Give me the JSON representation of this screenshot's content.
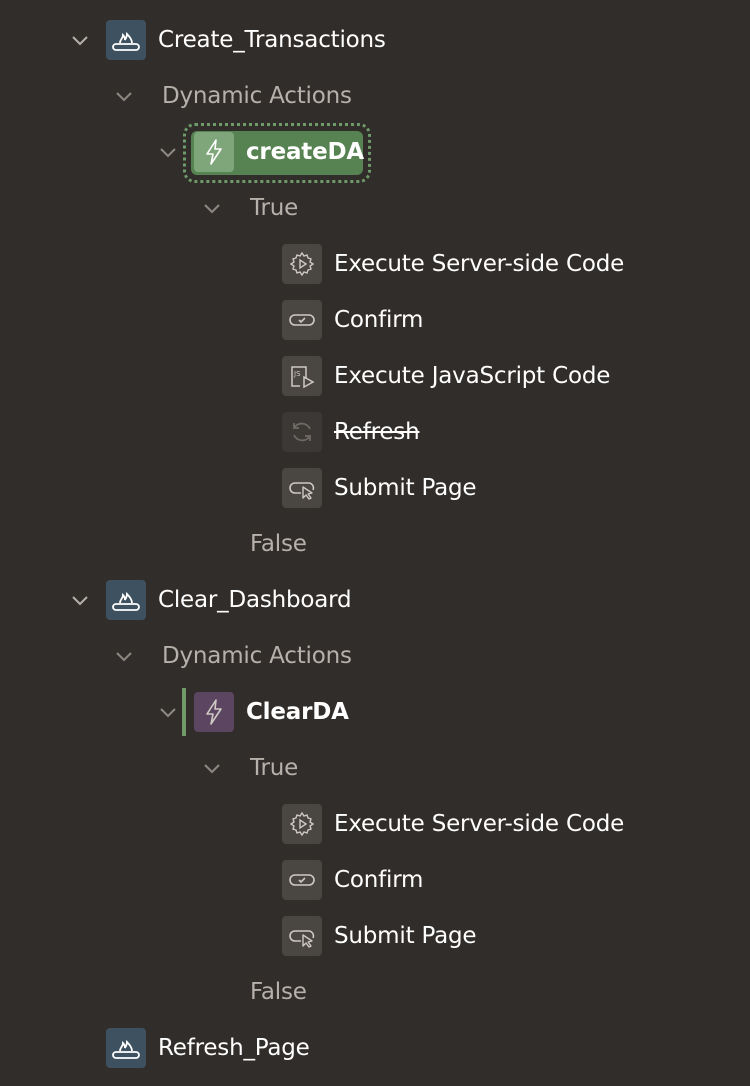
{
  "tree": {
    "buttons": [
      {
        "label": "Create_Transactions",
        "section_label": "Dynamic Actions",
        "dynamic_action": {
          "label": "createDA",
          "true_label": "True",
          "false_label": "False",
          "actions": [
            {
              "label": "Execute Server-side Code",
              "icon": "gear-play-icon"
            },
            {
              "label": "Confirm",
              "icon": "confirm-icon"
            },
            {
              "label": "Execute JavaScript Code",
              "icon": "javascript-icon"
            },
            {
              "label": "Refresh",
              "icon": "refresh-icon",
              "disabled": true
            },
            {
              "label": "Submit Page",
              "icon": "submit-page-icon"
            }
          ]
        }
      },
      {
        "label": "Clear_Dashboard",
        "section_label": "Dynamic Actions",
        "dynamic_action": {
          "label": "ClearDA",
          "true_label": "True",
          "false_label": "False",
          "actions": [
            {
              "label": "Execute Server-side Code",
              "icon": "gear-play-icon"
            },
            {
              "label": "Confirm",
              "icon": "confirm-icon"
            },
            {
              "label": "Submit Page",
              "icon": "submit-page-icon"
            }
          ]
        }
      },
      {
        "label": "Refresh_Page"
      }
    ]
  },
  "colors": {
    "background": "#312d2a",
    "selected": "#578352",
    "selected_border": "#6f9a6a",
    "button_icon_bg": "#3d5160",
    "da_purple": "#5b4560",
    "muted_text": "#b7b1ab"
  }
}
